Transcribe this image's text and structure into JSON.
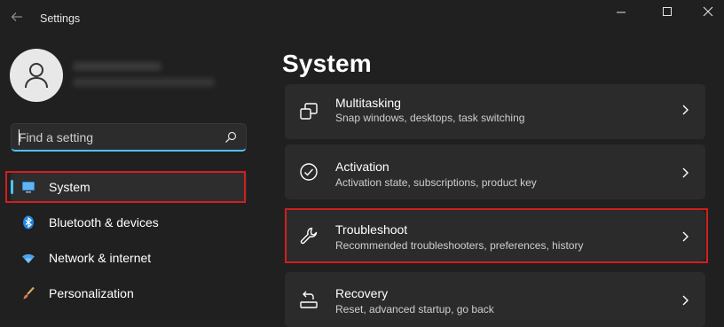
{
  "app": {
    "title": "Settings"
  },
  "search": {
    "placeholder": "Find a setting"
  },
  "sidebar": {
    "items": [
      {
        "label": "System",
        "icon": "monitor-icon",
        "selected": true
      },
      {
        "label": "Bluetooth & devices",
        "icon": "bluetooth-icon",
        "selected": false
      },
      {
        "label": "Network & internet",
        "icon": "wifi-icon",
        "selected": false
      },
      {
        "label": "Personalization",
        "icon": "brush-icon",
        "selected": false
      }
    ]
  },
  "main": {
    "title": "System",
    "cards": [
      {
        "title": "Multitasking",
        "subtitle": "Snap windows, desktops, task switching",
        "icon": "multitasking-icon"
      },
      {
        "title": "Activation",
        "subtitle": "Activation state, subscriptions, product key",
        "icon": "check-circle-icon"
      },
      {
        "title": "Troubleshoot",
        "subtitle": "Recommended troubleshooters, preferences, history",
        "icon": "wrench-icon"
      },
      {
        "title": "Recovery",
        "subtitle": "Reset, advanced startup, go back",
        "icon": "recovery-icon"
      }
    ]
  },
  "colors": {
    "accent": "#4cc2ff",
    "highlight": "#d11f1f",
    "background": "#202020",
    "card": "#2b2b2b"
  }
}
